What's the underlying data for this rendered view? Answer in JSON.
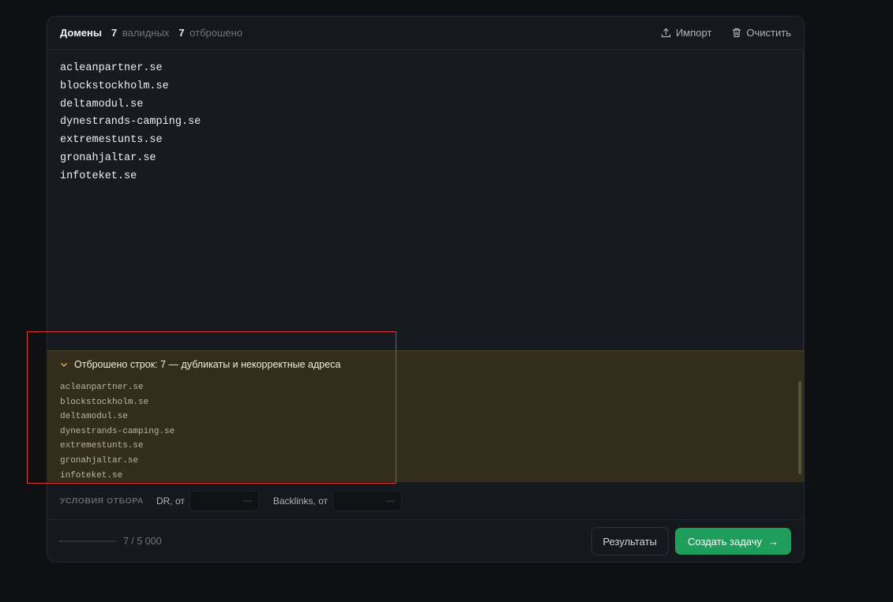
{
  "header": {
    "title": "Домены",
    "valid_count": "7",
    "valid_label": "валидных",
    "rejected_count": "7",
    "rejected_label": "отброшено",
    "import_label": "Импорт",
    "clear_label": "Очистить"
  },
  "domains": [
    "acleanpartner.se",
    "blockstockholm.se",
    "deltamodul.se",
    "dynestrands-camping.se",
    "extremestunts.se",
    "gronahjaltar.se",
    "infoteket.se"
  ],
  "rejected": {
    "heading": "Отброшено строк: 7 — дубликаты и некорректные адреса",
    "items": [
      "acleanpartner.se",
      "blockstockholm.se",
      "deltamodul.se",
      "dynestrands-camping.se",
      "extremestunts.se",
      "gronahjaltar.se",
      "infoteket.se"
    ]
  },
  "filters": {
    "label": "УСЛОВИЯ ОТБОРА",
    "dr_label": "DR, от",
    "dr_placeholder": "—",
    "backlinks_label": "Backlinks, от",
    "backlinks_placeholder": "—"
  },
  "footer": {
    "progress_fraction": 0.0014,
    "count_text": "7 / 5 000",
    "results_label": "Результаты",
    "create_label": "Создать задачу",
    "create_arrow": "→"
  },
  "colors": {
    "accent": "#1e9e5a",
    "warning_bg": "#332d1b",
    "annotation": "#e0353a"
  }
}
